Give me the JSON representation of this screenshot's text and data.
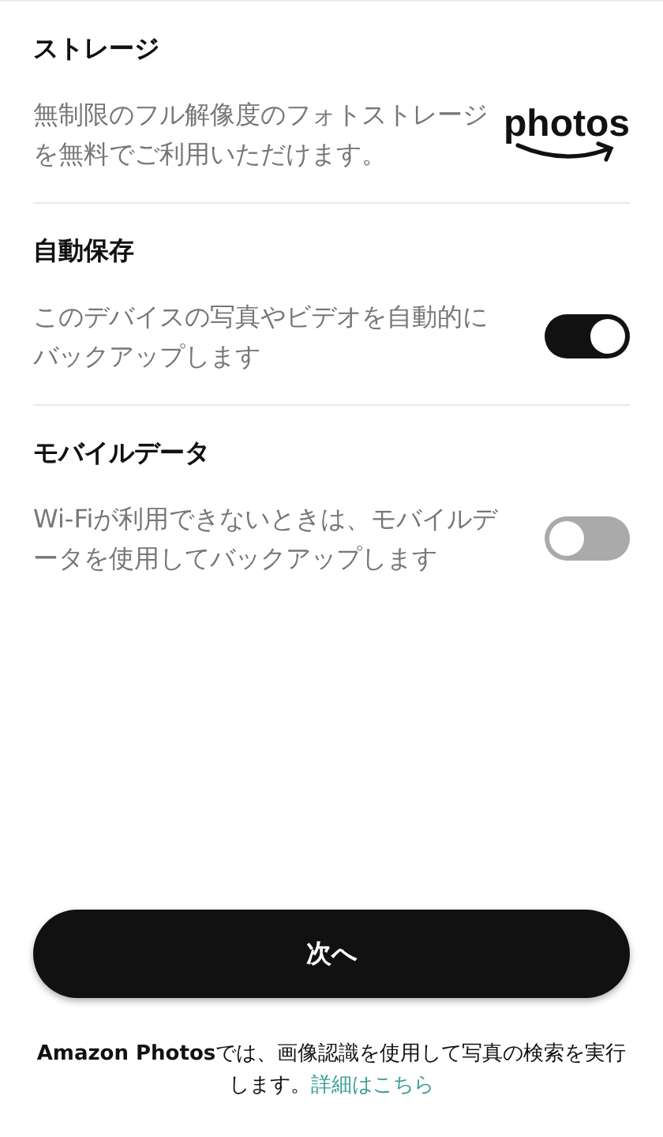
{
  "sections": [
    {
      "kind": "logo",
      "title": "ストレージ",
      "description": "無制限のフル解像度のフォトストレージを無料でご利用いただけます。",
      "logo": "photos"
    },
    {
      "kind": "toggle",
      "title": "自動保存",
      "description": "このデバイスの写真やビデオを自動的にバックアップします",
      "on": true
    },
    {
      "kind": "toggle",
      "title": "モバイルデータ",
      "description": "Wi-Fiが利用できないときは、モバイルデータを使用してバックアップします",
      "on": false
    }
  ],
  "next_button": "次へ",
  "footer": {
    "text": "**Amazon Photos**では、画像認識を使用して写真の検索を実行します。",
    "link": "詳細はこちら"
  }
}
